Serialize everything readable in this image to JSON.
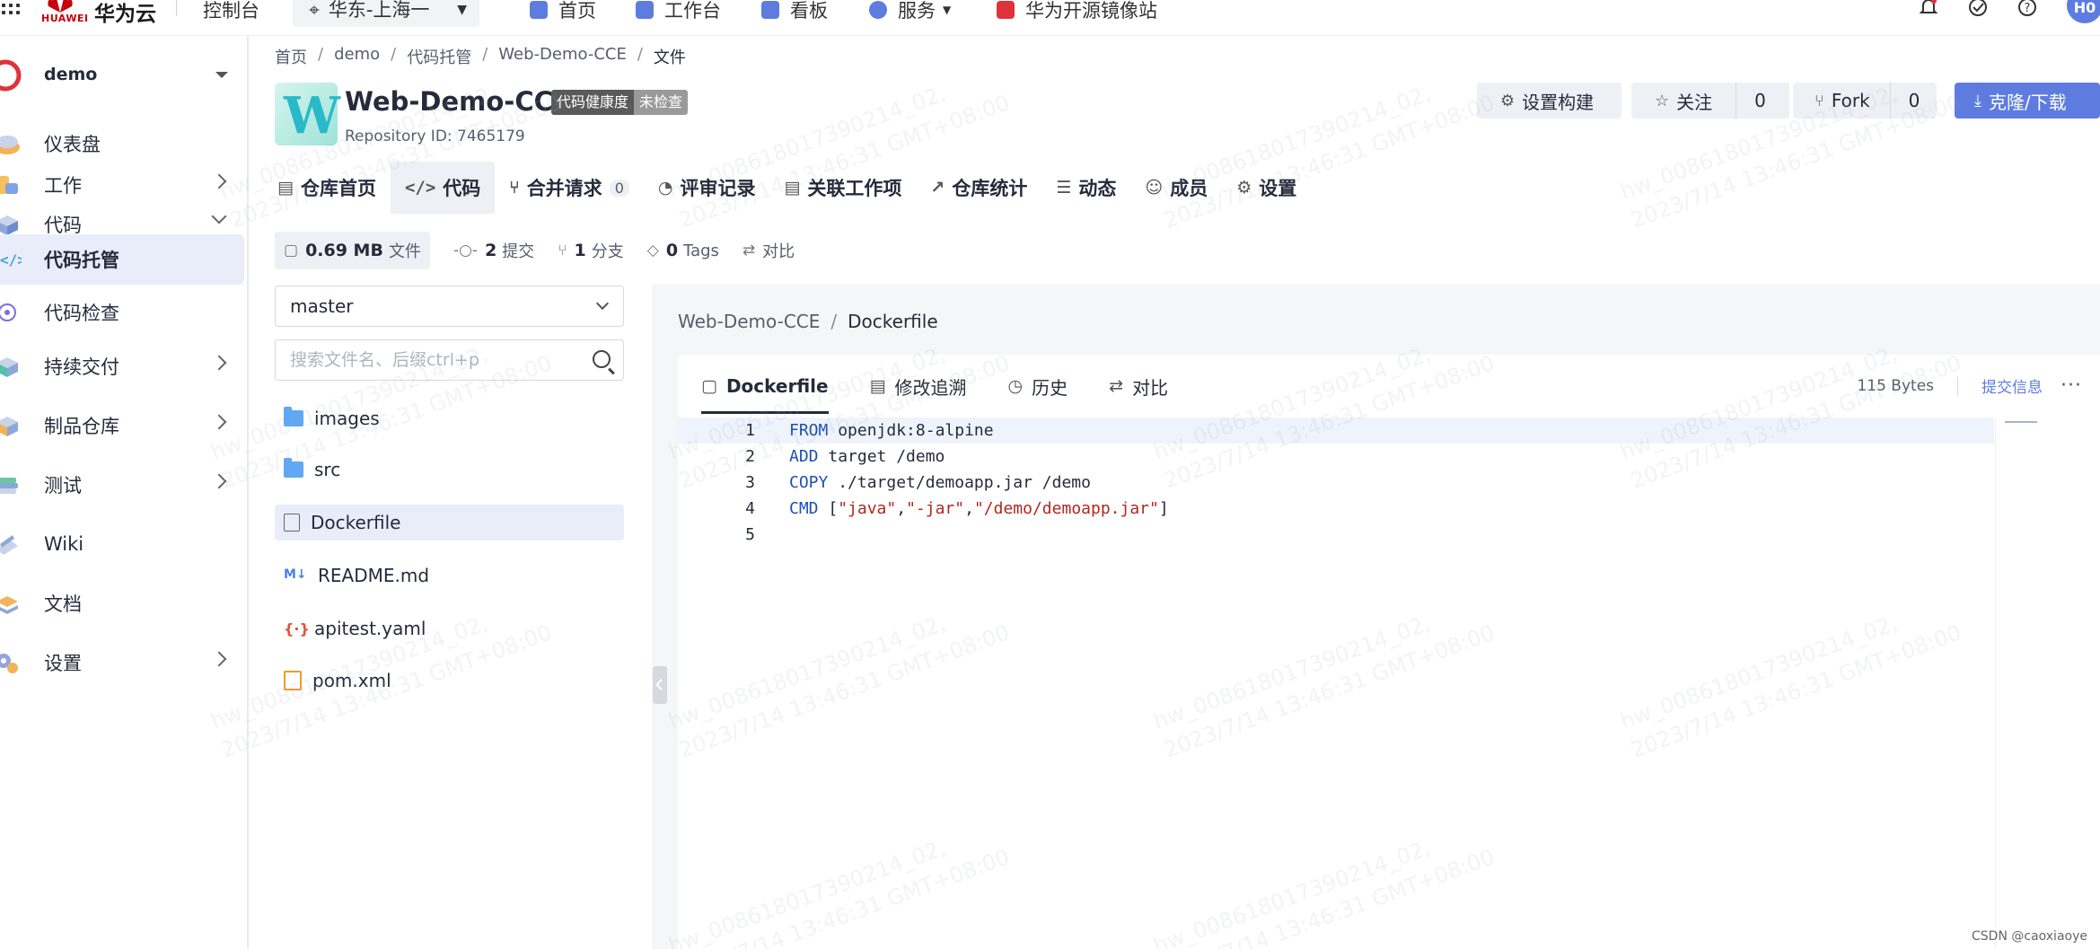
{
  "topbar": {
    "brand": "华为云",
    "logo_text": "HUAWEI",
    "console": "控制台",
    "region": "华东-上海一",
    "nav": [
      "首页",
      "工作台",
      "看板",
      "服务",
      "华为开源镜像站"
    ],
    "avatar": "H0"
  },
  "sidebar": {
    "project": "demo",
    "items": [
      {
        "label": "仪表盘"
      },
      {
        "label": "工作"
      },
      {
        "label": "代码"
      },
      {
        "label": "代码托管"
      },
      {
        "label": "代码检查"
      },
      {
        "label": "持续交付"
      },
      {
        "label": "制品仓库"
      },
      {
        "label": "测试"
      },
      {
        "label": "Wiki"
      },
      {
        "label": "文档"
      },
      {
        "label": "设置"
      }
    ]
  },
  "breadcrumb": [
    "首页",
    "demo",
    "代码托管",
    "Web-Demo-CCE",
    "文件"
  ],
  "repo": {
    "avatar_letter": "W",
    "name": "Web-Demo-CCE",
    "health_label": "代码健康度",
    "health_value": "未检查",
    "repo_id": "Repository ID: 7465179"
  },
  "actions": {
    "build": "设置构建",
    "watch": "关注",
    "watch_count": "0",
    "fork": "Fork",
    "fork_count": "0",
    "clone": "克隆/下载"
  },
  "tabs": [
    "仓库首页",
    "代码",
    "合并请求",
    "评审记录",
    "关联工作项",
    "仓库统计",
    "动态",
    "成员",
    "设置"
  ],
  "merge_count": "0",
  "stats": {
    "size": "0.69 MB",
    "size_label": "文件",
    "commits": "2",
    "commits_label": "提交",
    "branches": "1",
    "branches_label": "分支",
    "tags": "0",
    "tags_label": "Tags",
    "compare": "对比"
  },
  "branch": "master",
  "search_placeholder": "搜索文件名、后缀ctrl+p",
  "files": [
    "images",
    "src",
    "Dockerfile",
    "README.md",
    "apitest.yaml",
    "pom.xml"
  ],
  "viewer": {
    "crumb_repo": "Web-Demo-CCE",
    "crumb_file": "Dockerfile",
    "tabs": [
      "Dockerfile",
      "修改追溯",
      "历史",
      "对比"
    ],
    "size": "115 Bytes",
    "commit_info": "提交信息",
    "more": "···"
  },
  "code": [
    {
      "n": "1",
      "kw": "FROM",
      "rest": " openjdk:8-alpine"
    },
    {
      "n": "2",
      "kw": "ADD",
      "rest": " target /demo"
    },
    {
      "n": "3",
      "kw": "COPY",
      "rest": " ./target/demoapp.jar /demo"
    },
    {
      "n": "4",
      "kw": "CMD",
      "rest": ""
    },
    {
      "n": "5",
      "kw": "",
      "rest": ""
    }
  ],
  "code_line4": {
    "open": " [",
    "s1": "\"java\"",
    "c1": ",",
    "s2": "\"-jar\"",
    "c2": ",",
    "s3": "\"/demo/demoapp.jar\"",
    "close": "]"
  },
  "watermark": {
    "line1": "hw_008618017390214_02,",
    "line2": "2023/7/14 13:46:31 GMT+08:00"
  },
  "csdn": "CSDN @caoxiaoye",
  "colors": {
    "accent": "#5e7ce0",
    "brand_red": "#c7000b",
    "active_bg": "#e9edfa"
  }
}
